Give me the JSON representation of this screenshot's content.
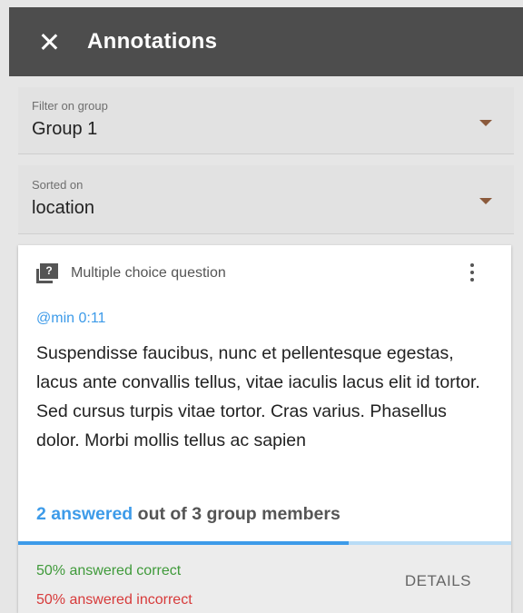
{
  "header": {
    "title": "Annotations"
  },
  "filter": {
    "label": "Filter on group",
    "value": "Group 1"
  },
  "sort": {
    "label": "Sorted on",
    "value": "location"
  },
  "card": {
    "type": "Multiple choice question",
    "type_icon": "question-icon",
    "timestamp": "@min 0:11",
    "body": "Suspendisse faucibus, nunc et pellentesque egestas, lacus ante convallis tellus, vitae iaculis lacus elit id tortor. Sed cursus turpis vitae tortor. Cras varius. Phasellus dolor. Morbi mollis tellus ac sapien",
    "answered_count": "2 answered",
    "answered_rest": " out of 3 group members",
    "progress": 0.67,
    "correct": "50% answered correct",
    "incorrect": "50% answered incorrect",
    "details_label": "DETAILS"
  },
  "colors": {
    "accent": "#3d9be9",
    "correct": "#3f9a3a",
    "incorrect": "#d73a3a",
    "topbar": "#4d4d4d"
  }
}
